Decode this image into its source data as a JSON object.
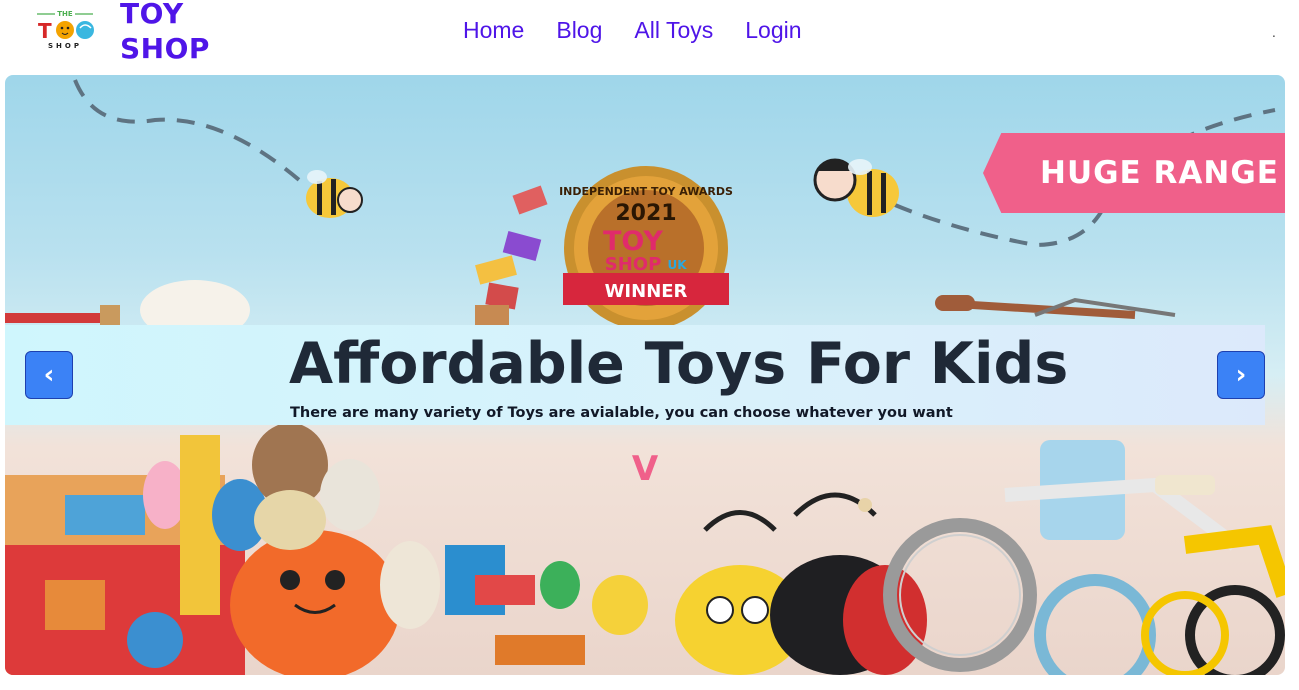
{
  "brand": {
    "logo_text_top": "THE",
    "logo_text_main": "TOY",
    "logo_text_bottom": "SHOP",
    "name_line1": "TOY",
    "name_line2": "SHOP"
  },
  "nav": {
    "items": [
      {
        "label": "Home"
      },
      {
        "label": "Blog"
      },
      {
        "label": "All Toys"
      },
      {
        "label": "Login"
      }
    ],
    "trailing": "."
  },
  "hero": {
    "title": "Affordable Toys For Kids",
    "subtitle": "There are many variety of Toys are avialable, you can choose whatever you want",
    "prev_label": "‹",
    "next_label": "›",
    "range_label": "HUGE RANGE",
    "award": {
      "top": "INDEPENDENT TOY AWARDS",
      "year": "2021",
      "brand_line1": "TOY",
      "brand_line2": "SHOP",
      "country": "UK",
      "ribbon": "WINNER"
    },
    "floor_letter": "V"
  },
  "colors": {
    "brand": "#4f15e8",
    "button": "#3b82f6",
    "range_tag": "#f0608a"
  }
}
